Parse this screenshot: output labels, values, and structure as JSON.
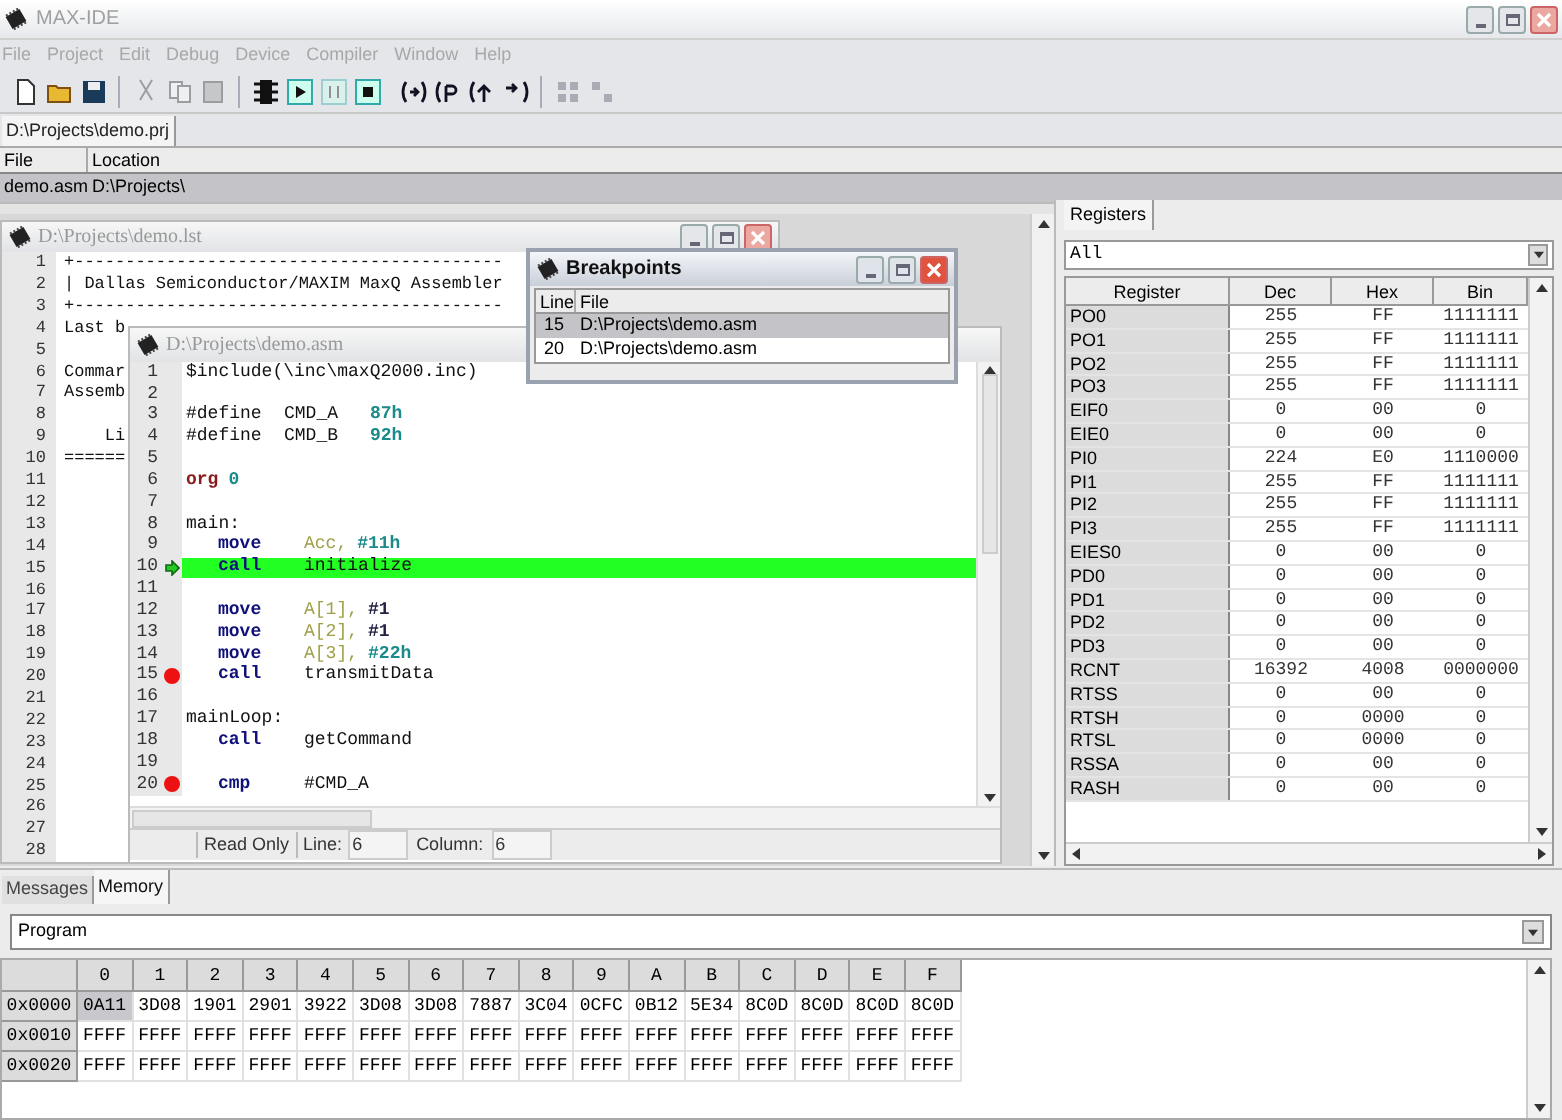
{
  "window": {
    "title": "MAX-IDE"
  },
  "menu": [
    "File",
    "Project",
    "Edit",
    "Debug",
    "Device",
    "Compiler",
    "Window",
    "Help"
  ],
  "project_tabs": [
    {
      "label": "D:\\Projects\\demo.prj",
      "selected": true
    }
  ],
  "files": {
    "columns": [
      "File",
      "Location"
    ],
    "rows": [
      {
        "cells": [
          "demo.asm",
          "D:\\Projects\\"
        ],
        "selected": true
      }
    ]
  },
  "listing_window": {
    "title": "D:\\Projects\\demo.lst",
    "lines": [
      {
        "number": "1",
        "text": "+------------------------------------------"
      },
      {
        "number": "2",
        "text": "| Dallas Semiconductor/MAXIM MaxQ Assembler"
      },
      {
        "number": "3",
        "text": "+------------------------------------------"
      },
      {
        "number": "4",
        "text": "Last b"
      },
      {
        "number": "5"
      },
      {
        "number": "6",
        "text": "Commar"
      },
      {
        "number": "7",
        "text": "Assemb"
      },
      {
        "number": "8"
      },
      {
        "number": "9",
        "text": "    Li"
      },
      {
        "number": "10",
        "text": "======"
      },
      {
        "number": "11"
      },
      {
        "number": "12"
      },
      {
        "number": "13"
      },
      {
        "number": "14"
      },
      {
        "number": "15"
      },
      {
        "number": "16"
      },
      {
        "number": "17"
      },
      {
        "number": "18"
      },
      {
        "number": "19"
      },
      {
        "number": "20"
      },
      {
        "number": "21"
      },
      {
        "number": "22"
      },
      {
        "number": "23"
      },
      {
        "number": "24"
      },
      {
        "number": "25"
      },
      {
        "number": "26"
      },
      {
        "number": "27"
      },
      {
        "number": "28"
      }
    ]
  },
  "editor_window": {
    "title": "D:\\Projects\\demo.asm",
    "lines": [
      {
        "number": "1",
        "breakpoint": false,
        "current": false,
        "kind": "label",
        "segments": [
          {
            "kind": "text",
            "text": "$include(\\inc\\maxQ2000.inc)"
          }
        ]
      },
      {
        "number": "2",
        "breakpoint": false,
        "current": false,
        "kind": "label"
      },
      {
        "number": "3",
        "breakpoint": false,
        "current": false,
        "kind": "define",
        "segments": [
          {
            "kind": "text",
            "text": "#define"
          },
          {
            "kind": "text",
            "text": "CMD_A"
          },
          {
            "kind": "number",
            "text": "87h"
          }
        ]
      },
      {
        "number": "4",
        "breakpoint": false,
        "current": false,
        "kind": "define",
        "segments": [
          {
            "kind": "text",
            "text": "#define"
          },
          {
            "kind": "text",
            "text": "CMD_B"
          },
          {
            "kind": "number",
            "text": "92h"
          }
        ]
      },
      {
        "number": "5",
        "breakpoint": false,
        "current": false,
        "kind": "label"
      },
      {
        "number": "6",
        "breakpoint": false,
        "current": false,
        "kind": "label",
        "segments": [
          {
            "kind": "keyword",
            "text": "org"
          },
          {
            "kind": "number",
            "text": "0"
          }
        ]
      },
      {
        "number": "7",
        "breakpoint": false,
        "current": false,
        "kind": "label"
      },
      {
        "number": "8",
        "breakpoint": false,
        "current": false,
        "kind": "label",
        "segments": [
          {
            "kind": "text",
            "text": "main:"
          }
        ]
      },
      {
        "number": "9",
        "breakpoint": false,
        "current": false,
        "kind": "instruction",
        "segments": [
          {
            "kind": "opcode",
            "text": "move"
          },
          {
            "kind": "register",
            "text": "Acc,"
          },
          {
            "kind": "number",
            "text": "#11h"
          }
        ]
      },
      {
        "number": "10",
        "breakpoint": false,
        "current": true,
        "kind": "instruction",
        "segments": [
          {
            "kind": "opcode",
            "text": "call"
          },
          {
            "kind": "text",
            "text": "initialize"
          }
        ]
      },
      {
        "number": "11",
        "breakpoint": false,
        "current": false,
        "kind": "label"
      },
      {
        "number": "12",
        "breakpoint": false,
        "current": false,
        "kind": "instruction",
        "segments": [
          {
            "kind": "opcode",
            "text": "move"
          },
          {
            "kind": "register",
            "text": "A[1],"
          },
          {
            "kind": "immediate",
            "text": "#1"
          }
        ]
      },
      {
        "number": "13",
        "breakpoint": false,
        "current": false,
        "kind": "instruction",
        "segments": [
          {
            "kind": "opcode",
            "text": "move"
          },
          {
            "kind": "register",
            "text": "A[2],"
          },
          {
            "kind": "immediate",
            "text": "#1"
          }
        ]
      },
      {
        "number": "14",
        "breakpoint": false,
        "current": false,
        "kind": "instruction",
        "segments": [
          {
            "kind": "opcode",
            "text": "move"
          },
          {
            "kind": "register",
            "text": "A[3],"
          },
          {
            "kind": "number",
            "text": "#22h"
          }
        ]
      },
      {
        "number": "15",
        "breakpoint": true,
        "current": false,
        "kind": "instruction",
        "segments": [
          {
            "kind": "opcode",
            "text": "call"
          },
          {
            "kind": "text",
            "text": "transmitData"
          }
        ]
      },
      {
        "number": "16",
        "breakpoint": false,
        "current": false,
        "kind": "label"
      },
      {
        "number": "17",
        "breakpoint": false,
        "current": false,
        "kind": "label",
        "segments": [
          {
            "kind": "text",
            "text": "mainLoop:"
          }
        ]
      },
      {
        "number": "18",
        "breakpoint": false,
        "current": false,
        "kind": "instruction",
        "segments": [
          {
            "kind": "opcode",
            "text": "call"
          },
          {
            "kind": "text",
            "text": "getCommand"
          }
        ]
      },
      {
        "number": "19",
        "breakpoint": false,
        "current": false,
        "kind": "label"
      },
      {
        "number": "20",
        "breakpoint": true,
        "current": false,
        "kind": "instruction",
        "segments": [
          {
            "kind": "opcode",
            "text": "cmp"
          },
          {
            "kind": "text",
            "text": "#CMD_A"
          }
        ]
      }
    ],
    "status": {
      "mode": "Read Only",
      "line_label": "Line:",
      "line": "6",
      "column_label": "Column:",
      "column": "6"
    }
  },
  "breakpoints_window": {
    "title": "Breakpoints",
    "columns": [
      "Line",
      "File"
    ],
    "rows": [
      {
        "line": "15",
        "file": "D:\\Projects\\demo.asm",
        "selected": true
      },
      {
        "line": "20",
        "file": "D:\\Projects\\demo.asm",
        "selected": false
      }
    ]
  },
  "registers": {
    "tab": {
      "label": "Registers",
      "selected": true
    },
    "filter": "All",
    "columns": [
      "Register",
      "Dec",
      "Hex",
      "Bin"
    ],
    "rows": [
      [
        "PO0",
        "255",
        "FF",
        "1111111"
      ],
      [
        "PO1",
        "255",
        "FF",
        "1111111"
      ],
      [
        "PO2",
        "255",
        "FF",
        "1111111"
      ],
      [
        "PO3",
        "255",
        "FF",
        "1111111"
      ],
      [
        "EIF0",
        "0",
        "00",
        "0"
      ],
      [
        "EIE0",
        "0",
        "00",
        "0"
      ],
      [
        "PI0",
        "224",
        "E0",
        "1110000"
      ],
      [
        "PI1",
        "255",
        "FF",
        "1111111"
      ],
      [
        "PI2",
        "255",
        "FF",
        "1111111"
      ],
      [
        "PI3",
        "255",
        "FF",
        "1111111"
      ],
      [
        "EIES0",
        "0",
        "00",
        "0"
      ],
      [
        "PD0",
        "0",
        "00",
        "0"
      ],
      [
        "PD1",
        "0",
        "00",
        "0"
      ],
      [
        "PD2",
        "0",
        "00",
        "0"
      ],
      [
        "PD3",
        "0",
        "00",
        "0"
      ],
      [
        "RCNT",
        "16392",
        "4008",
        "0000000"
      ],
      [
        "RTSS",
        "0",
        "00",
        "0"
      ],
      [
        "RTSH",
        "0",
        "0000",
        "0"
      ],
      [
        "RTSL",
        "0",
        "0000",
        "0"
      ],
      [
        "RSSA",
        "0",
        "00",
        "0"
      ],
      [
        "RASH",
        "0",
        "00",
        "0"
      ]
    ]
  },
  "bottom_tabs": [
    {
      "label": "Messages",
      "selected": false
    },
    {
      "label": "Memory",
      "selected": true
    }
  ],
  "memory": {
    "space": "Program",
    "columns": [
      "0",
      "1",
      "2",
      "3",
      "4",
      "5",
      "6",
      "7",
      "8",
      "9",
      "A",
      "B",
      "C",
      "D",
      "E",
      "F"
    ],
    "rows": [
      {
        "address": "0x0000",
        "cells": [
          {
            "value": "0A11",
            "selected": true
          },
          {
            "value": "3D08",
            "selected": false
          },
          {
            "value": "1901",
            "selected": false
          },
          {
            "value": "2901",
            "selected": false
          },
          {
            "value": "3922",
            "selected": false
          },
          {
            "value": "3D08",
            "selected": false
          },
          {
            "value": "3D08",
            "selected": false
          },
          {
            "value": "7887",
            "selected": false
          },
          {
            "value": "3C04",
            "selected": false
          },
          {
            "value": "0CFC",
            "selected": false
          },
          {
            "value": "0B12",
            "selected": false
          },
          {
            "value": "5E34",
            "selected": false
          },
          {
            "value": "8C0D",
            "selected": false
          },
          {
            "value": "8C0D",
            "selected": false
          },
          {
            "value": "8C0D",
            "selected": false
          },
          {
            "value": "8C0D",
            "selected": false
          }
        ]
      },
      {
        "address": "0x0010",
        "cells": [
          {
            "value": "FFFF",
            "selected": false
          },
          {
            "value": "FFFF",
            "selected": false
          },
          {
            "value": "FFFF",
            "selected": false
          },
          {
            "value": "FFFF",
            "selected": false
          },
          {
            "value": "FFFF",
            "selected": false
          },
          {
            "value": "FFFF",
            "selected": false
          },
          {
            "value": "FFFF",
            "selected": false
          },
          {
            "value": "FFFF",
            "selected": false
          },
          {
            "value": "FFFF",
            "selected": false
          },
          {
            "value": "FFFF",
            "selected": false
          },
          {
            "value": "FFFF",
            "selected": false
          },
          {
            "value": "FFFF",
            "selected": false
          },
          {
            "value": "FFFF",
            "selected": false
          },
          {
            "value": "FFFF",
            "selected": false
          },
          {
            "value": "FFFF",
            "selected": false
          },
          {
            "value": "FFFF",
            "selected": false
          }
        ]
      },
      {
        "address": "0x0020",
        "cells": [
          {
            "value": "FFFF",
            "selected": false
          },
          {
            "value": "FFFF",
            "selected": false
          },
          {
            "value": "FFFF",
            "selected": false
          },
          {
            "value": "FFFF",
            "selected": false
          },
          {
            "value": "FFFF",
            "selected": false
          },
          {
            "value": "FFFF",
            "selected": false
          },
          {
            "value": "FFFF",
            "selected": false
          },
          {
            "value": "FFFF",
            "selected": false
          },
          {
            "value": "FFFF",
            "selected": false
          },
          {
            "value": "FFFF",
            "selected": false
          },
          {
            "value": "FFFF",
            "selected": false
          },
          {
            "value": "FFFF",
            "selected": false
          },
          {
            "value": "FFFF",
            "selected": false
          },
          {
            "value": "FFFF",
            "selected": false
          },
          {
            "value": "FFFF",
            "selected": false
          },
          {
            "value": "FFFF",
            "selected": false
          }
        ]
      }
    ]
  }
}
